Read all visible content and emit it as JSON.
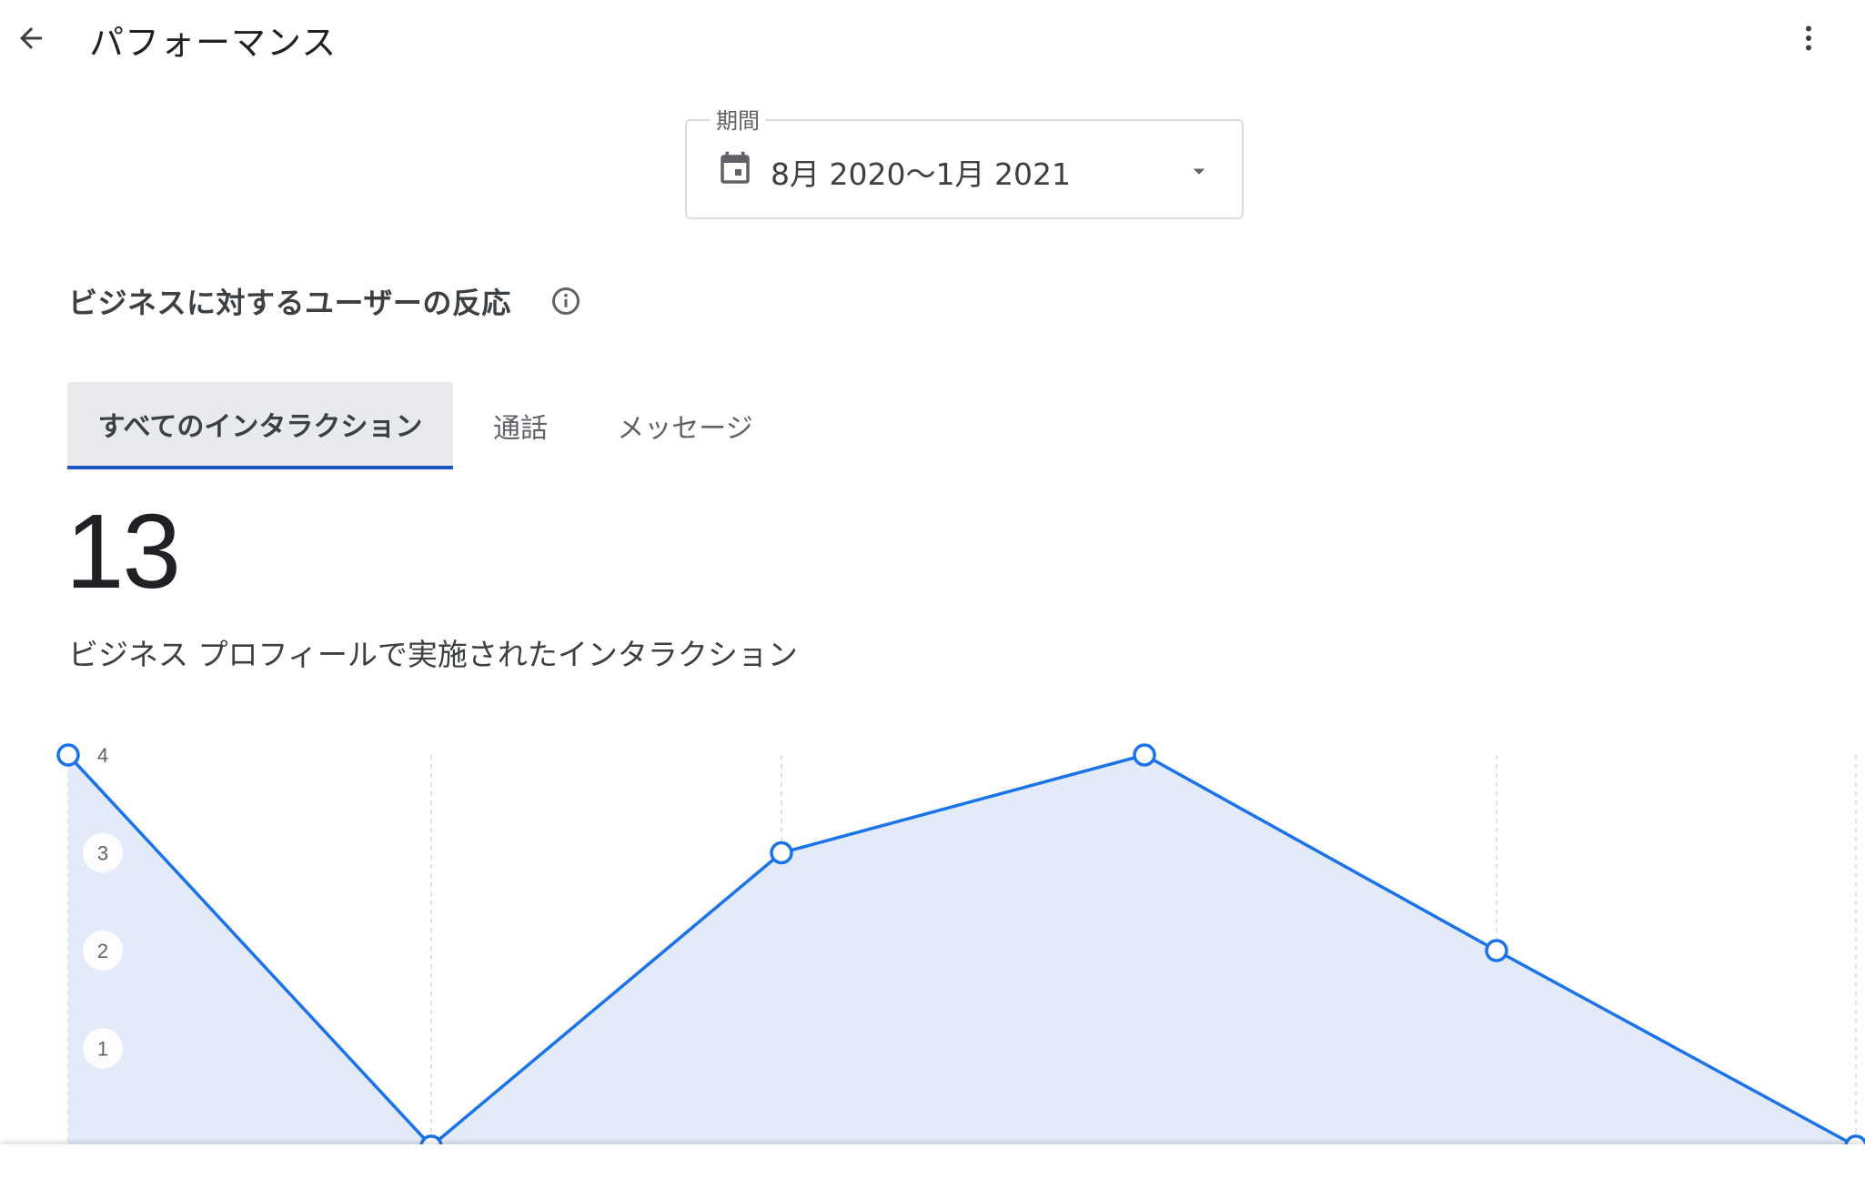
{
  "header": {
    "title": "パフォーマンス",
    "back_icon": "arrow-back-icon",
    "more_icon": "more-vert-icon"
  },
  "period": {
    "label": "期間",
    "value": "8月 2020〜1月 2021",
    "calendar_icon": "calendar-icon",
    "dropdown_icon": "dropdown-arrow-icon"
  },
  "section": {
    "title": "ビジネスに対するユーザーの反応",
    "info_icon": "info-icon"
  },
  "tabs": [
    {
      "label": "すべてのインタラクション",
      "active": true
    },
    {
      "label": "通話",
      "active": false
    },
    {
      "label": "メッセージ",
      "active": false
    }
  ],
  "metric": {
    "value": "13",
    "caption": "ビジネス プロフィールで実施されたインタラクション"
  },
  "colors": {
    "line": "#1a73e8",
    "area": "#e3ebfb",
    "tab_indicator": "#1a56c4"
  },
  "chart_data": {
    "type": "area",
    "x": [
      1,
      2,
      3,
      4,
      5,
      6
    ],
    "values": [
      4,
      0,
      3,
      4,
      2,
      0
    ],
    "y_ticks": [
      "1",
      "2",
      "3",
      "4"
    ],
    "ylim": [
      0,
      4
    ],
    "grid": "vertical-dashed"
  }
}
